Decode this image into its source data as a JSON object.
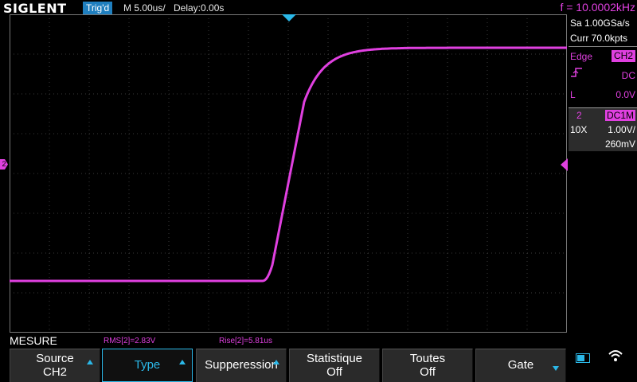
{
  "topbar": {
    "logo": "SIGLENT",
    "trig_status": "Trig'd",
    "timebase": "M 5.00us/",
    "delay": "Delay:0.00s",
    "frequency": "f = 10.0002kHz"
  },
  "right_panel": {
    "sample_rate": "Sa 1.00GSa/s",
    "memory": "Curr 70.0kpts",
    "trigger": {
      "type_label": "Edge",
      "source": "CH2",
      "slope_icon": "rising-edge-icon",
      "coupling": "DC",
      "mode": "L",
      "level": "0.0V"
    },
    "channel": {
      "number": "2",
      "coupling_impedance": "DC1M",
      "probe": "10X",
      "volts_div": "1.00V/",
      "offset": "260mV"
    }
  },
  "markers": {
    "ch2_left": "2"
  },
  "measure": {
    "title": "MESURE",
    "items": [
      "RMS[2]=2.83V",
      "Rise[2]=5.81us"
    ]
  },
  "softkeys": [
    {
      "line1": "Source",
      "line2": "CH2",
      "arrow": "up"
    },
    {
      "line1": "Type",
      "line2": "",
      "arrow": "up",
      "active": true
    },
    {
      "line1": "Supperession",
      "line2": "",
      "arrow": "up"
    },
    {
      "line1": "Statistique",
      "line2": "Off",
      "arrow": ""
    },
    {
      "line1": "Toutes",
      "line2": "Off",
      "arrow": ""
    },
    {
      "line1": "Gate",
      "line2": "",
      "arrow": "down"
    }
  ],
  "colors": {
    "ch2": "#e040e0",
    "accent": "#2bb8e8",
    "grid": "#3a3a3a"
  }
}
